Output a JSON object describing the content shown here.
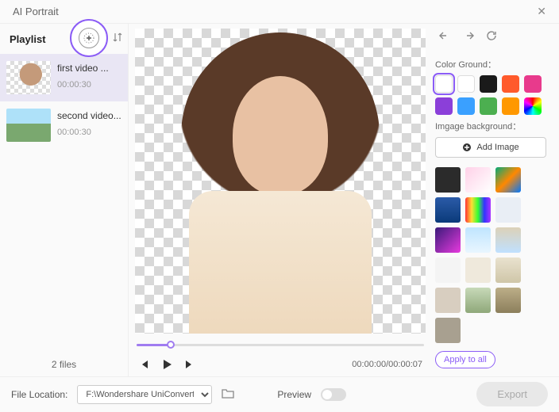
{
  "title": "AI Portrait",
  "playlist": {
    "label": "Playlist",
    "items": [
      {
        "name": "first video ...",
        "duration": "00:00:30"
      },
      {
        "name": "second video...",
        "duration": "00:00:30"
      }
    ],
    "count": "2 files"
  },
  "player": {
    "time": "00:00:00/00:00:07"
  },
  "panel": {
    "colorground": "Color Ground：",
    "swatches": [
      "#ffffff",
      "#ffffff",
      "#1a1a1a",
      "#ff5a2b",
      "#e83a8c",
      "#8b3fd9",
      "#3aa0ff",
      "#4caf50",
      "#ff9800",
      "rainbow"
    ],
    "imgbg": "Imgage background：",
    "addimg": "Add Image",
    "bgthumbs": [
      "#2b2b2b",
      "linear-gradient(135deg,#ffd1e8,#fff)",
      "linear-gradient(135deg,#0a7,#f80,#07f)",
      "linear-gradient(#2b5ba8,#0a3a7a)",
      "linear-gradient(90deg,#f33,#fd3,#3f3,#33f,#a3f)",
      "#e9eef5",
      "linear-gradient(135deg,#3a1a7a,#e83adf)",
      "linear-gradient(#bfe5ff,#e9f6ff)",
      "linear-gradient(#dcd1b8,#c0e0ff)",
      "#f4f4f4",
      "#efe9dc",
      "linear-gradient(#e9e2cf,#cfc6a8)",
      "#d8cec0",
      "linear-gradient(#c7d9b8,#8fa87a)",
      "linear-gradient(#bcae88,#8c7f5c)",
      "#a8a090"
    ],
    "apply": "Apply to all"
  },
  "footer": {
    "filelocation": "File Location:",
    "path": "F:\\Wondershare UniConverte...",
    "preview": "Preview",
    "export": "Export"
  }
}
